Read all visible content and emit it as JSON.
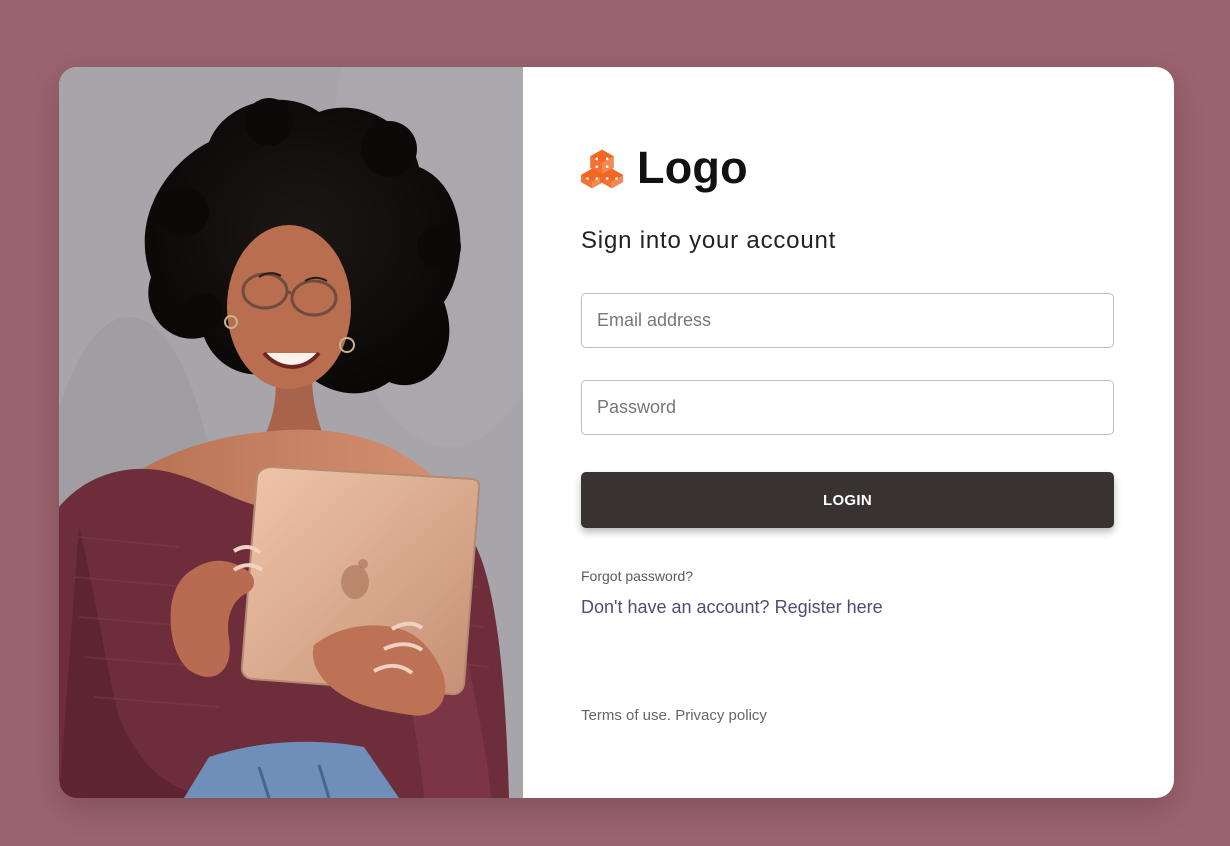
{
  "brand": {
    "logo_text": "Logo",
    "icon": "cubes-icon",
    "accent_color": "#f26522"
  },
  "login": {
    "title": "Sign into your account",
    "email_placeholder": "Email address",
    "password_placeholder": "Password",
    "button_label": "LOGIN",
    "forgot_password": "Forgot password?",
    "register_text": "Don't have an account? Register here"
  },
  "footer": {
    "terms": "Terms of use.",
    "privacy": "Privacy policy"
  },
  "colors": {
    "background": "#9b636d",
    "button": "#383233",
    "link": "#4b4d79"
  }
}
